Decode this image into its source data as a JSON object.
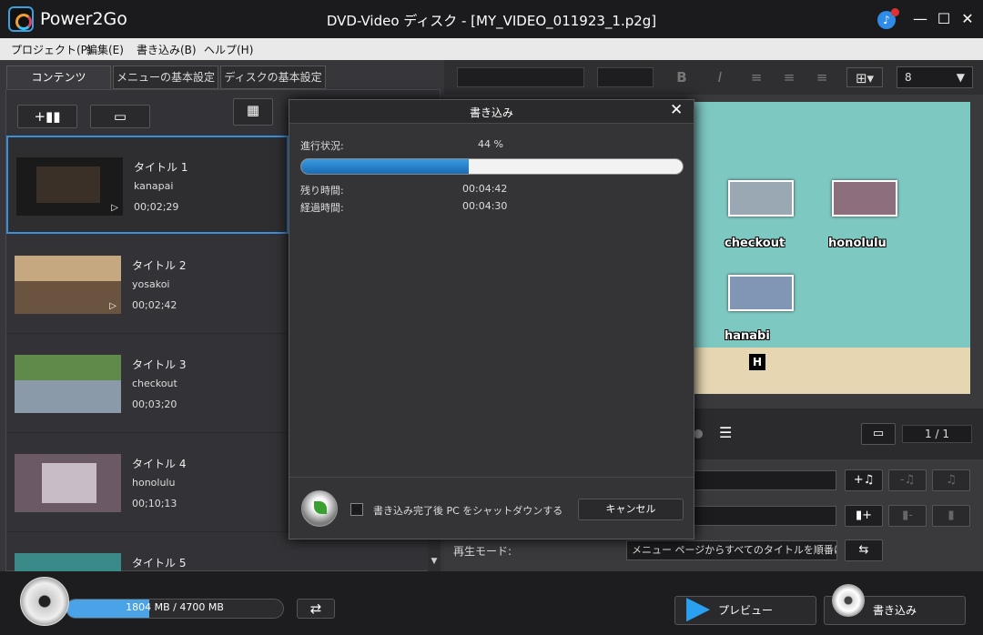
{
  "window": {
    "app_name": "Power2Go",
    "title": "DVD-Video ディスク - [MY_VIDEO_011923_1.p2g]",
    "notification_badge": "N"
  },
  "menubar": [
    "プロジェクト(P)",
    "編集(E)",
    "書き込み(B)",
    "ヘルプ(H)"
  ],
  "tabs": [
    "コンテンツ",
    "メニューの基本設定",
    "ディスクの基本設定"
  ],
  "titles": [
    {
      "name": "タイトル 1",
      "sub": "kanapai",
      "duration": "00;02;29"
    },
    {
      "name": "タイトル 2",
      "sub": "yosakoi",
      "duration": "00;02;42"
    },
    {
      "name": "タイトル 3",
      "sub": "checkout",
      "duration": "00;03;20"
    },
    {
      "name": "タイトル 4",
      "sub": "honolulu",
      "duration": "00;10;13"
    },
    {
      "name": "タイトル 5",
      "sub": "",
      "duration": ""
    }
  ],
  "format_bar": {
    "font_size": "8"
  },
  "menu_preview": {
    "items": [
      "checkout",
      "honolulu",
      "hanabi"
    ],
    "highlight_key": "H",
    "page": "1 / 1"
  },
  "playback": {
    "label": "再生モード:",
    "value": "メニュー ページからすべてのタイトルを順番に再..."
  },
  "bottom": {
    "capacity_text": "1804 MB / 4700 MB",
    "capacity_fraction": 0.384,
    "preview_label": "プレビュー",
    "burn_label": "書き込み"
  },
  "dialog": {
    "title": "書き込み",
    "progress_label": "進行状況:",
    "progress_value": "44 %",
    "progress_fraction": 0.44,
    "remaining_label": "残り時間:",
    "remaining_value": "00:04:42",
    "elapsed_label": "経過時間:",
    "elapsed_value": "00:04:30",
    "shutdown_label": "書き込み完了後 PC をシャットダウンする",
    "cancel_label": "キャンセル"
  },
  "colors": {
    "accent": "#3d8ed8",
    "progress": "#1f7fd0"
  }
}
